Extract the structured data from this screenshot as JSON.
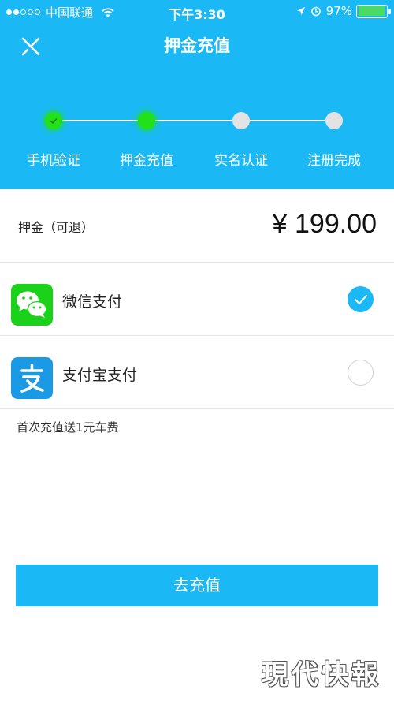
{
  "status_bar": {
    "carrier": "中国联通",
    "time": "下午3:30",
    "battery": "97%",
    "battery_level": 0.97
  },
  "header": {
    "title": "押金充值",
    "close_icon": "close-x-icon"
  },
  "steps": [
    {
      "label": "手机验证",
      "state": "done"
    },
    {
      "label": "押金充值",
      "state": "current"
    },
    {
      "label": "实名认证",
      "state": "todo"
    },
    {
      "label": "注册完成",
      "state": "todo"
    }
  ],
  "deposit": {
    "label": "押金（可退）",
    "amount": "¥ 199.00"
  },
  "payment_methods": [
    {
      "label": "微信支付",
      "icon": "wechat-icon",
      "selected": true
    },
    {
      "label": "支付宝支付",
      "icon": "alipay-icon",
      "selected": false
    }
  ],
  "promo_text": "首次充值送1元车费",
  "submit_label": "去充值",
  "watermark": "現代快報",
  "colors": {
    "primary": "#1ab9f5",
    "step_active": "#22e01a",
    "step_inactive": "#e3e3e3",
    "wechat": "#1aad19",
    "alipay": "#1a9ae5"
  }
}
